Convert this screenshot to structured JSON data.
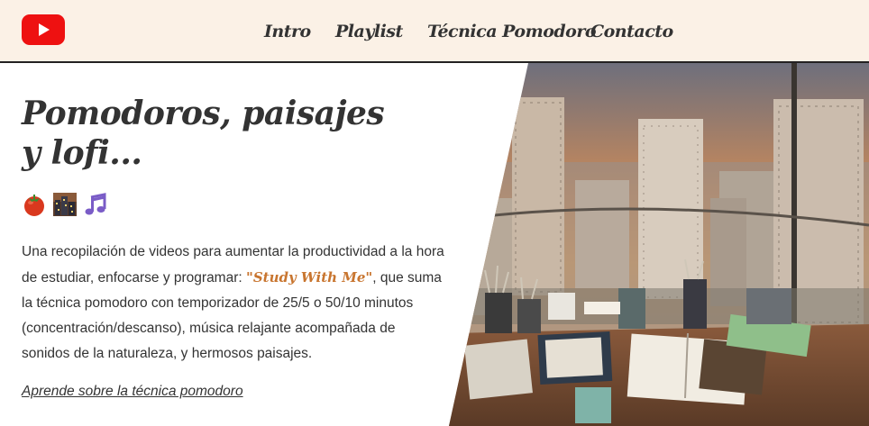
{
  "header": {
    "logo": "youtube-logo",
    "nav": [
      {
        "label": "Intro"
      },
      {
        "label": "Playlist"
      },
      {
        "label": "Técnica Pomodoro"
      },
      {
        "label": "Contacto"
      }
    ]
  },
  "hero": {
    "title": "Pomodoros, paisajes y lofi...",
    "emojis": [
      "tomato-icon",
      "cityscape-icon",
      "music-notes-icon"
    ],
    "desc_before": "Una recopilación de videos para aumentar la productividad a la hora de estudiar, enfocarse y programar: ",
    "desc_highlight": "\"Study With Me\"",
    "desc_after": ", que suma la técnica pomodoro con temporizador de 25/5 o 50/10 minutos (concentración/descanso), música relajante acompañada de sonidos de la naturaleza, y hermosos paisajes.",
    "link": "Aprende sobre la técnica pomodoro"
  },
  "colors": {
    "header_bg": "#fbf1e6",
    "text": "#333333",
    "accent": "#c8752f",
    "logo_red": "#ee1111"
  }
}
